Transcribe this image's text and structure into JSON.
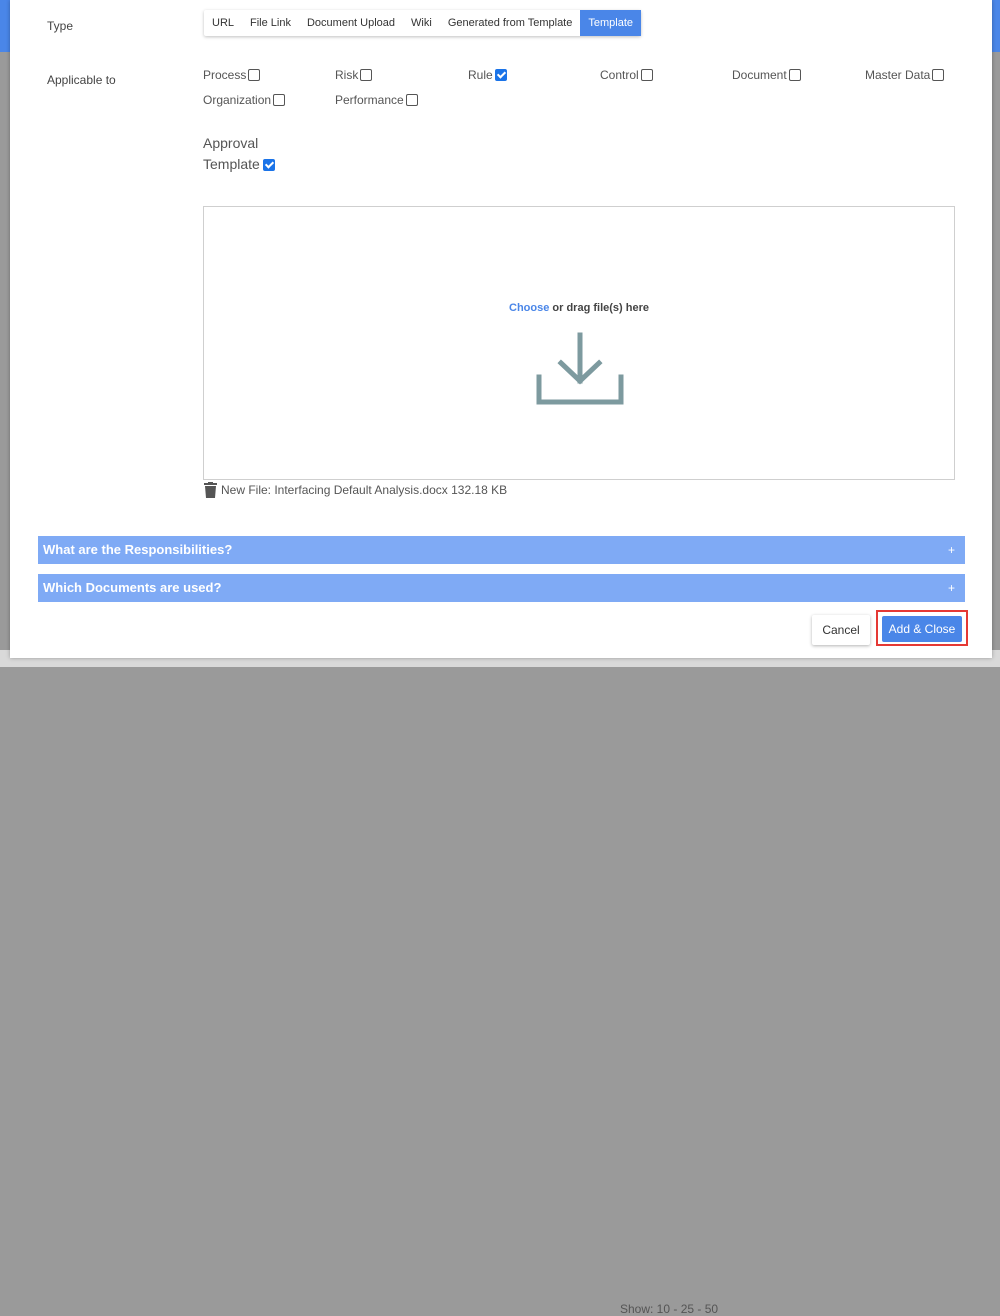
{
  "form": {
    "type_label": "Type",
    "applicable_label": "Applicable to",
    "type_tabs": [
      {
        "label": "URL",
        "active": false
      },
      {
        "label": "File Link",
        "active": false
      },
      {
        "label": "Document Upload",
        "active": false
      },
      {
        "label": "Wiki",
        "active": false
      },
      {
        "label": "Generated from Template",
        "active": false
      },
      {
        "label": "Template",
        "active": true
      }
    ],
    "applicable": [
      {
        "label": "Process",
        "checked": false
      },
      {
        "label": "Risk",
        "checked": false
      },
      {
        "label": "Rule",
        "checked": true
      },
      {
        "label": "Control",
        "checked": false
      },
      {
        "label": "Document",
        "checked": false
      },
      {
        "label": "Master Data",
        "checked": false
      },
      {
        "label": "Organization",
        "checked": false
      },
      {
        "label": "Performance",
        "checked": false
      }
    ],
    "approval_line1": "Approval",
    "approval_line2": "Template",
    "approval_checked": true
  },
  "dropzone": {
    "choose_link": "Choose",
    "text": " or drag file(s) here"
  },
  "file": {
    "text": "New File: Interfacing Default Analysis.docx 132.18 KB"
  },
  "accordions": [
    {
      "title": "What are the Responsibilities?",
      "icon": "+"
    },
    {
      "title": "Which Documents are used?",
      "icon": "+"
    }
  ],
  "footer": {
    "cancel_label": "Cancel",
    "add_close_label": "Add & Close",
    "background_text": "Show: 10 - 25 - 50"
  },
  "colors": {
    "accent": "#4a86e8",
    "accordion": "#7faaf5",
    "highlight": "#e53935"
  }
}
